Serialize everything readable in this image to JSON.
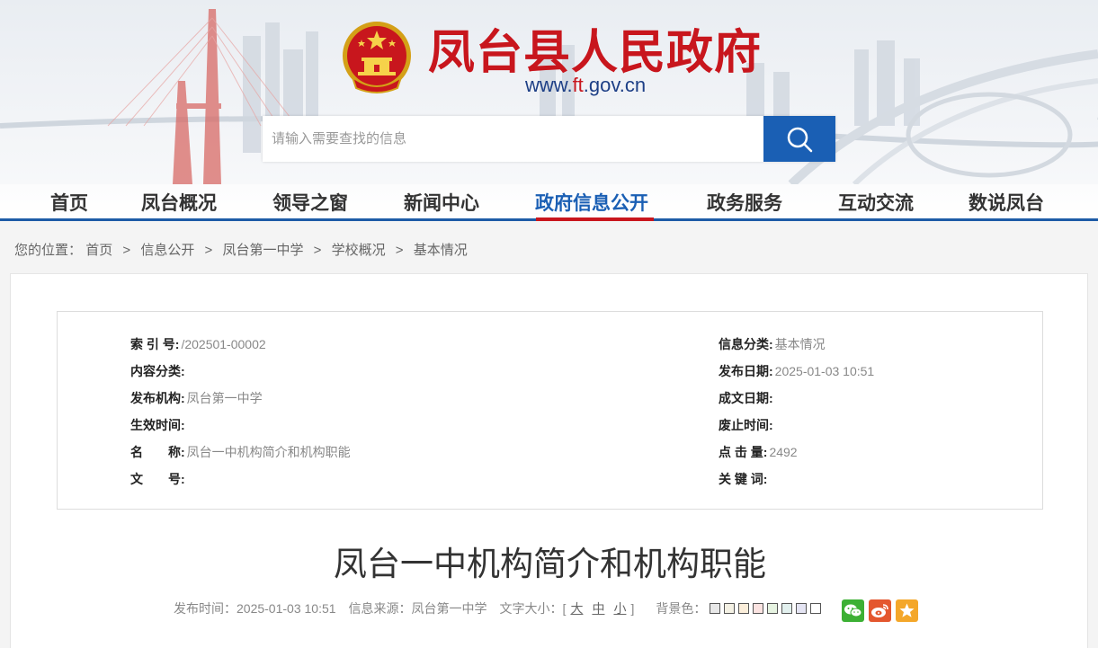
{
  "site": {
    "title": "凤台县人民政府",
    "url_prefix": "www.",
    "url_highlight": "ft",
    "url_suffix": ".gov.cn"
  },
  "search": {
    "placeholder": "请输入需要查找的信息",
    "icon": "search-icon"
  },
  "nav": {
    "items": [
      "首页",
      "凤台概况",
      "领导之窗",
      "新闻中心",
      "政府信息公开",
      "政务服务",
      "互动交流",
      "数说凤台"
    ],
    "active": "政府信息公开"
  },
  "breadcrumb": {
    "prefix": "您的位置：",
    "items": [
      "首页",
      "信息公开",
      "凤台第一中学",
      "学校概况",
      "基本情况"
    ]
  },
  "meta": {
    "left": [
      {
        "label": "索 引 号:",
        "value": "/202501-00002"
      },
      {
        "label": "内容分类:",
        "value": ""
      },
      {
        "label": "发布机构:",
        "value": "凤台第一中学"
      },
      {
        "label": "生效时间:",
        "value": ""
      },
      {
        "label": "名　　称:",
        "value": "凤台一中机构简介和机构职能"
      },
      {
        "label": "文　　号:",
        "value": ""
      }
    ],
    "right": [
      {
        "label": "信息分类:",
        "value": "基本情况"
      },
      {
        "label": "发布日期:",
        "value": "2025-01-03 10:51"
      },
      {
        "label": "成文日期:",
        "value": ""
      },
      {
        "label": "废止时间:",
        "value": ""
      },
      {
        "label": "点 击 量:",
        "value": "2492"
      },
      {
        "label": "关 键 词:",
        "value": ""
      }
    ]
  },
  "article": {
    "title": "凤台一中机构简介和机构职能",
    "publish_label": "发布时间：",
    "publish_time": "2025-01-03 10:51",
    "source_label": "信息来源：",
    "source": "凤台第一中学",
    "font_size_label": "文字大小：[",
    "font_sizes": [
      "大",
      "中",
      "小"
    ],
    "font_size_close": "]",
    "bg_label": "背景色：",
    "bg_colors": [
      "#e8e8e8",
      "#f4f1e4",
      "#fbeeda",
      "#fbe3e1",
      "#e6f3e1",
      "#e2f0ee",
      "#e4e4f3",
      "#ffffff"
    ]
  },
  "share": {
    "icons": [
      "wechat-icon",
      "weibo-icon",
      "favorite-icon"
    ],
    "colors": [
      "#3cb034",
      "#e4572e",
      "#f4a72a"
    ]
  },
  "colors": {
    "brand_red": "#c8161d",
    "brand_blue": "#1a5fb4",
    "nav_line": "#1d5ba6"
  }
}
